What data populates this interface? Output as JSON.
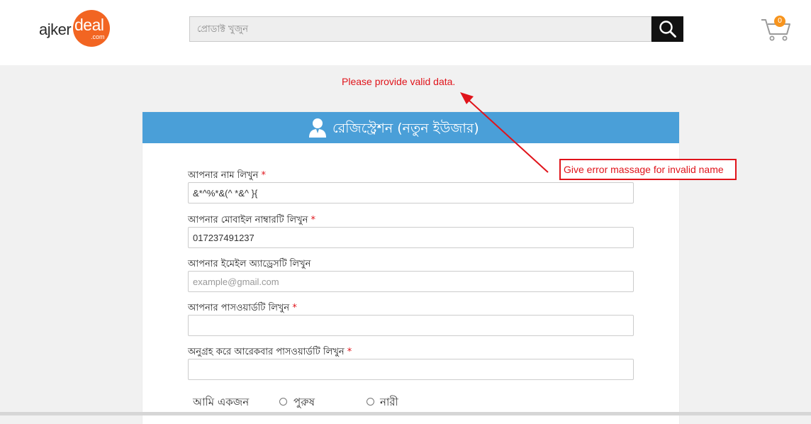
{
  "header": {
    "logo": {
      "part1": "ajker",
      "part2": "deal",
      "part3": ".com"
    },
    "search": {
      "placeholder": "প্রোডাক্ট খুজুন",
      "icon": "search-icon"
    },
    "cart": {
      "count": "0",
      "icon": "cart-icon"
    }
  },
  "error_message": "Please provide valid data.",
  "form": {
    "title": "রেজিস্ট্রেশন (নতুন ইউজার)",
    "title_icon": "user-icon",
    "fields": [
      {
        "label": "আপনার নাম লিখুন",
        "required": "*",
        "value": "&*^%*&(^ *&^ }{",
        "placeholder": ""
      },
      {
        "label": "আপনার মোবাইল নাম্বারটি লিখুন",
        "required": "*",
        "value": "017237491237",
        "placeholder": ""
      },
      {
        "label": "আপনার ইমেইল অ্যাড্রেসটি লিখুন",
        "required": "",
        "value": "",
        "placeholder": "example@gmail.com"
      },
      {
        "label": "আপনার পাসওয়ার্ডটি লিখুন",
        "required": "*",
        "value": "",
        "placeholder": ""
      },
      {
        "label": "অনুগ্রহ করে আরেকবার পাসওয়ার্ডটি লিখুন",
        "required": "*",
        "value": "",
        "placeholder": ""
      }
    ],
    "gender": {
      "label": "আমি একজন",
      "options": [
        "পুরুষ",
        "নারী"
      ]
    }
  },
  "annotation": {
    "text": "Give error massage for invalid name"
  },
  "colors": {
    "accent": "#4a9fd8",
    "error": "#e0141b",
    "brand": "#f26522"
  }
}
